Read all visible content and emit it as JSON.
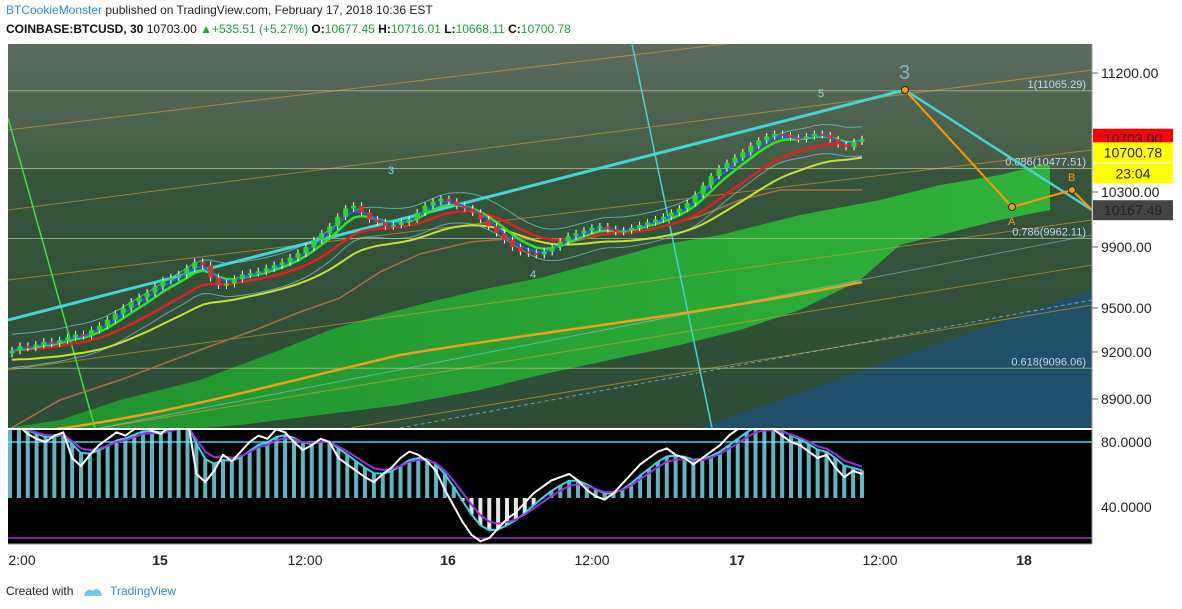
{
  "header": {
    "author": "BTCookieMonster",
    "published": " published on TradingView.com, February 17, 2018 10:36 EST",
    "symbol": "COINBASE:BTCUSD, 30",
    "last": "10703.00",
    "change": "+535.51 (+5.27%)",
    "o_label": "O:",
    "o_value": "10677.45",
    "h_label": "H:",
    "h_value": "10716.01",
    "l_label": "L:",
    "l_value": "10668.11",
    "c_label": "C:",
    "c_value": "10700.78"
  },
  "footer": {
    "created": "Created with",
    "brand": "TradingView"
  },
  "colors": {
    "candle_up": "#2bd62b",
    "candle_down": "#d83131",
    "ema_fast": "#1e5cff",
    "ema_mid": "#2ee32e",
    "ema_slow": "#e02020",
    "kijun": "#c8e03a",
    "trend": "#46d3d3",
    "abc": "#ff9900",
    "ma_long": "#f0a020",
    "stoch_k": "#ffffff",
    "stoch_d": "#9b30e0",
    "stoch_s": "#30d8e8"
  },
  "chart_data": {
    "type": "line",
    "title": "",
    "y_axis": {
      "ticks": [
        "11200.00",
        "10300.00",
        "9900.00",
        "9500.00",
        "9200.00",
        "8900.00"
      ],
      "ylim": [
        8700,
        11400
      ]
    },
    "price_labels": [
      {
        "text": "10703.00",
        "value": 10703,
        "bg": "#ff0000",
        "fg": "#ffffff"
      },
      {
        "text": "10700.78",
        "value": 10600,
        "bg": "#ffff00",
        "fg": "#000000"
      },
      {
        "text": "23:04",
        "value": 10440,
        "bg": "#ffff00",
        "fg": "#000000"
      },
      {
        "text": "10167.49",
        "value": 10167.49,
        "bg": "#444444",
        "fg": "#ffffff"
      }
    ],
    "x_ticks": [
      "2:00",
      "15",
      "12:00",
      "16",
      "12:00",
      "17",
      "12:00",
      "18"
    ],
    "fib_levels": [
      {
        "text": "1(11065.29)",
        "value": 11065.29
      },
      {
        "text": "0.886(10477.51)",
        "value": 10477.51
      },
      {
        "text": "0.786(9962.11)",
        "value": 9962.11
      },
      {
        "text": "0.618(9096.06)",
        "value": 9096.06
      }
    ],
    "wave_labels": [
      "3",
      "4",
      "5",
      "3",
      "A",
      "B"
    ],
    "close": [
      9210,
      9240,
      9230,
      9250,
      9270,
      9260,
      9280,
      9300,
      9320,
      9310,
      9350,
      9380,
      9420,
      9460,
      9500,
      9540,
      9570,
      9600,
      9640,
      9680,
      9700,
      9720,
      9760,
      9800,
      9780,
      9700,
      9650,
      9660,
      9690,
      9720,
      9730,
      9740,
      9760,
      9780,
      9800,
      9830,
      9860,
      9900,
      9950,
      10000,
      10050,
      10120,
      10180,
      10200,
      10150,
      10100,
      10080,
      10050,
      10060,
      10080,
      10100,
      10150,
      10200,
      10230,
      10250,
      10230,
      10200,
      10180,
      10150,
      10100,
      10050,
      10000,
      9950,
      9900,
      9870,
      9860,
      9850,
      9870,
      9900,
      9940,
      9980,
      10000,
      10020,
      10040,
      10050,
      10030,
      10010,
      10020,
      10040,
      10060,
      10080,
      10100,
      10120,
      10150,
      10180,
      10220,
      10280,
      10350,
      10420,
      10480,
      10520,
      10560,
      10600,
      10650,
      10690,
      10720,
      10740,
      10730,
      10710,
      10700,
      10720,
      10740,
      10730,
      10700,
      10660,
      10640,
      10680,
      10700
    ],
    "stoch_k": [
      88,
      90,
      85,
      82,
      80,
      84,
      86,
      70,
      65,
      72,
      78,
      82,
      86,
      84,
      88,
      90,
      87,
      85,
      90,
      92,
      95,
      60,
      55,
      62,
      72,
      68,
      74,
      80,
      84,
      82,
      88,
      86,
      80,
      75,
      78,
      82,
      80,
      70,
      66,
      62,
      58,
      55,
      60,
      64,
      70,
      74,
      72,
      68,
      62,
      50,
      40,
      30,
      22,
      18,
      20,
      26,
      32,
      36,
      42,
      48,
      52,
      56,
      58,
      60,
      56,
      50,
      46,
      44,
      48,
      54,
      60,
      66,
      70,
      74,
      76,
      72,
      70,
      66,
      70,
      74,
      78,
      84,
      88,
      92,
      94,
      90,
      88,
      84,
      80,
      78,
      74,
      70,
      72,
      64,
      58,
      62,
      60
    ],
    "stoch_levels": [
      "80.0000",
      "40.0000"
    ]
  }
}
